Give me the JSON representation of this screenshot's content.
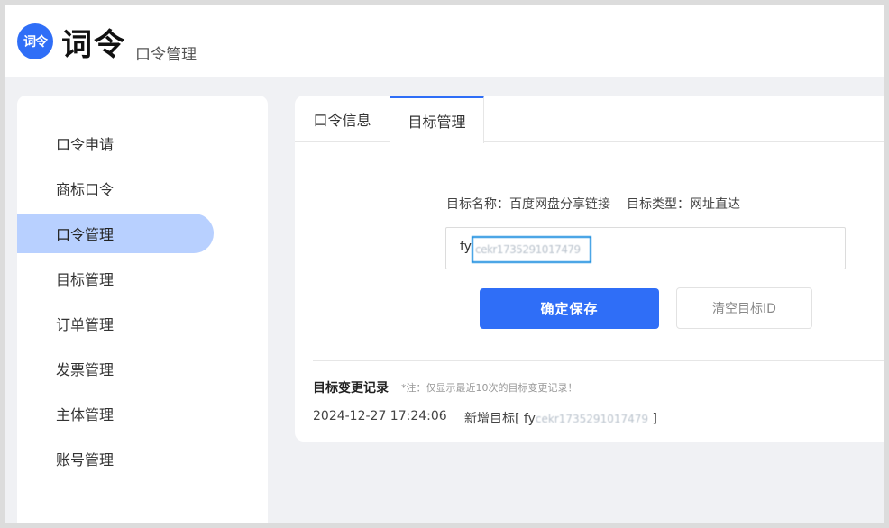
{
  "header": {
    "logo_text": "词令",
    "brand": "词令",
    "subtitle": "口令管理"
  },
  "sidebar": {
    "items": [
      {
        "label": "口令申请"
      },
      {
        "label": "商标口令"
      },
      {
        "label": "口令管理",
        "active": true
      },
      {
        "label": "目标管理"
      },
      {
        "label": "订单管理"
      },
      {
        "label": "发票管理"
      },
      {
        "label": "主体管理"
      },
      {
        "label": "账号管理"
      }
    ]
  },
  "main": {
    "tabs": [
      {
        "label": "口令信息"
      },
      {
        "label": "目标管理",
        "active": true
      }
    ],
    "target_name_label": "目标名称：",
    "target_name": "百度网盘分享链接",
    "target_type_label": "目标类型：",
    "target_type": "网址直达",
    "id_prefix": "fy",
    "id_value": "cekr1735291017479",
    "save_label": "确定保存",
    "clear_label": "清空目标ID",
    "log_title": "目标变更记录",
    "log_note": "*注：仅显示最近10次的目标变更记录！",
    "log_entries": [
      {
        "time": "2024-12-27 17:24:06",
        "action_prefix": "新增目标[ fy",
        "action_value": "cekr1735291017479",
        "action_suffix": " ]"
      }
    ]
  },
  "colors": {
    "accent": "#2f6ef7",
    "active_nav_bg": "#b8d0ff",
    "focus_border": "#1e8fe0"
  }
}
